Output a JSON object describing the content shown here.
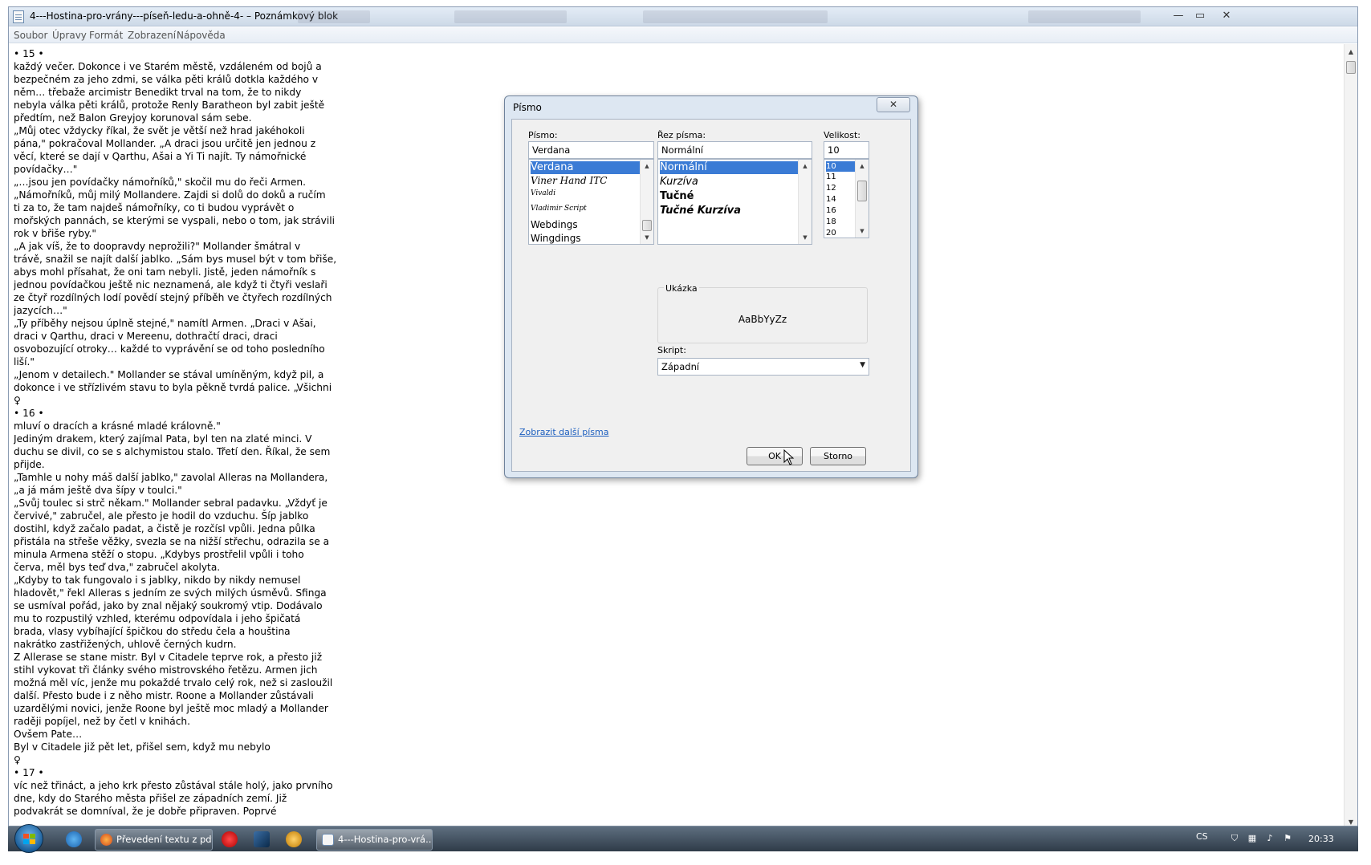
{
  "window": {
    "title": "4---Hostina-pro-vrány---píseň-ledu-a-ohně-4- – Poznámkový blok",
    "controls": {
      "minimize": "—",
      "maximize": "▭",
      "close": "✕"
    }
  },
  "menu": [
    "Soubor",
    "Úpravy",
    "Formát",
    "Zobrazení",
    "Nápověda"
  ],
  "editor_lines": [
    "• 15 •",
    "každý večer. Dokonce i ve Starém městě, vzdáleném od bojů a",
    "bezpečném za jeho zdmi, se válka pěti králů dotkla každého v",
    "něm… třebaže arcimistr Benedikt trval na tom, že to nikdy",
    "nebyla válka pěti králů, protože Renly Baratheon byl zabit ještě",
    "předtím, než Balon Greyjoy korunoval sám sebe.",
    "„Můj otec vždycky říkal, že svět je větší než hrad jakéhokoli",
    "pána,\" pokračoval Mollander. „A draci jsou určitě jen jednou z",
    "věcí, které se dají v Qarthu, Ašai a Yi Ti najít. Ty námořnické",
    "povídačky…\"",
    "„…jsou jen povídačky námořníků,\" skočil mu do řeči Armen.",
    "„Námořníků, můj milý Mollandere. Zajdi si dolů do doků a ručím",
    "ti za to, že tam najdeš námořníky, co ti budou vyprávět o",
    "mořských pannách, se kterými se vyspali, nebo o tom, jak strávili",
    "rok v břiše ryby.\"",
    "„A jak víš, že to doopravdy neprožili?\" Mollander šmátral v",
    "trávě, snažil se najít další jablko. „Sám bys musel být v tom břiše,",
    "abys mohl přísahat, že oni tam nebyli. Jistě, jeden námořník s",
    "jednou povídačkou ještě nic neznamená, ale když ti čtyři veslaři",
    "ze čtyř rozdílných lodí povědí stejný příběh ve čtyřech rozdílných",
    "jazycích…\"",
    "„Ty příběhy nejsou úplně stejné,\" namítl Armen. „Draci v Ašai,",
    "draci v Qarthu, draci v Mereenu, dothračtí draci, draci",
    "osvobozující otroky… každé to vyprávění se od toho posledního",
    "liší.\"",
    "„Jenom v detailech.\" Mollander se stával umíněným, když pil, a",
    "dokonce i ve střízlivém stavu to byla pěkně tvrdá palice. „Všichni",
    "♀",
    "• 16 •",
    "mluví o dracích a krásné mladé královně.\"",
    "Jediným drakem, který zajímal Pata, byl ten na zlaté minci. V",
    "duchu se divil, co se s alchymistou stalo. Třetí den. Říkal, že sem",
    "přijde.",
    "„Tamhle u nohy máš další jablko,\" zavolal Alleras na Mollandera,",
    "„a já mám ještě dva šípy v toulci.\"",
    "„Svůj toulec si strč někam.\" Mollander sebral padavku. „Vždyť je",
    "červivé,\" zabručel, ale přesto je hodil do vzduchu. Šíp jablko",
    "dostihl, když začalo padat, a čistě je rozčísl vpůli. Jedna půlka",
    "přistála na střeše věžky, svezla se na nižší střechu, odrazila se a",
    "minula Armena stěží o stopu. „Kdybys prostřelil vpůli i toho",
    "červa, měl bys teď dva,\" zabručel akolyta.",
    "„Kdyby to tak fungovalo i s jablky, nikdo by nikdy nemusel",
    "hladovět,\" řekl Alleras s jedním ze svých milých úsměvů. Sfinga",
    "se usmíval pořád, jako by znal nějaký soukromý vtip. Dodávalo",
    "mu to rozpustilý vzhled, kterému odpovídala i jeho špičatá",
    "brada, vlasy vybíhající špičkou do středu čela a houština",
    "nakrátko zastřižených, uhlově černých kudrn.",
    "Z Allerase se stane mistr. Byl v Citadele teprve rok, a přesto již",
    "stihl vykovat tři články svého mistrovského řetězu. Armen jich",
    "možná měl víc, jenže mu pokaždé trvalo celý rok, než si zasloužil",
    "další. Přesto bude i z něho mistr. Roone a Mollander zůstávali",
    "uzardělými novici, jenže Roone byl ještě moc mladý a Mollander",
    "raději popíjel, než by četl v knihách.",
    "Ovšem Pate…",
    "Byl v Citadele již pět let, přišel sem, když mu nebylo",
    "♀",
    "• 17 •",
    "víc než třináct, a jeho krk přesto zůstával stále holý, jako prvního",
    "dne, kdy do Starého města přišel ze západních zemí. Již",
    "podvakrát se domníval, že je dobře připraven. Poprvé"
  ],
  "dialog": {
    "title": "Písmo",
    "close": "✕",
    "font_label": "Písmo:",
    "font_value": "Verdana",
    "fonts": [
      "Verdana",
      "Viner Hand ITC",
      "Vivaldi",
      "Vladimir Script",
      "Webdings",
      "Wingdings"
    ],
    "style_label": "Řez písma:",
    "style_value": "Normální",
    "styles": [
      "Normální",
      "Kurzíva",
      "Tučné",
      "Tučné Kurzíva"
    ],
    "size_label": "Velikost:",
    "size_value": "10",
    "sizes": [
      "10",
      "11",
      "12",
      "14",
      "16",
      "18",
      "20"
    ],
    "sample_label": "Ukázka",
    "sample_text": "AaBbYyZz",
    "script_label": "Skript:",
    "script_value": "Západní",
    "more_fonts_link": "Zobrazit další písma",
    "ok_label": "OK",
    "cancel_label": "Storno"
  },
  "taskbar": {
    "buttons": [
      "Převedení textu z pdf...",
      "4---Hostina-pro-vrá..."
    ],
    "language": "CS",
    "clock": "20:33"
  },
  "colors": {
    "selection": "#3a7bd5",
    "link": "#1d5fbf",
    "taskbar": "#2f3b48"
  }
}
